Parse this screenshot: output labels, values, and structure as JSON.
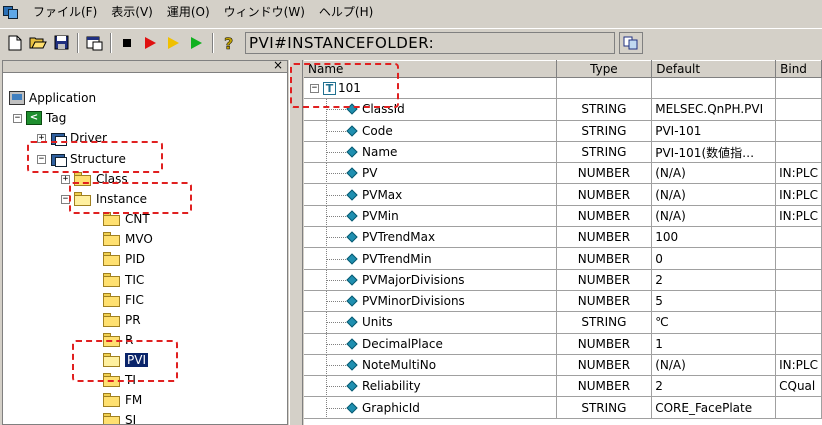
{
  "menu": {
    "items": [
      "ファイル(F)",
      "表示(V)",
      "運用(O)",
      "ウィンドウ(W)",
      "ヘルプ(H)"
    ]
  },
  "toolbar": {
    "path_value": "PVI#INSTANCEFOLDER:"
  },
  "tree": {
    "close_label": "×",
    "nodes": [
      {
        "label": "Application",
        "expander": ""
      },
      {
        "label": "Tag",
        "expander": "−"
      },
      {
        "label": "Driver",
        "expander": "+"
      },
      {
        "label": "Structure",
        "expander": "−"
      },
      {
        "label": "Class",
        "expander": "+"
      },
      {
        "label": "Instance",
        "expander": "−"
      },
      {
        "label": "CNT"
      },
      {
        "label": "MVO"
      },
      {
        "label": "PID"
      },
      {
        "label": "TIC"
      },
      {
        "label": "FIC"
      },
      {
        "label": "PR"
      },
      {
        "label": "R"
      },
      {
        "label": "PVI"
      },
      {
        "label": "TI"
      },
      {
        "label": "FM"
      },
      {
        "label": "SI"
      }
    ]
  },
  "grid": {
    "columns": [
      "Name",
      "Type",
      "Default",
      "Bind"
    ],
    "root": {
      "label": "101",
      "expander": "−"
    },
    "rows": [
      {
        "name": "ClassId",
        "type": "STRING",
        "default": "MELSEC.QnPH.PVI",
        "bind": ""
      },
      {
        "name": "Code",
        "type": "STRING",
        "default": "PVI-101",
        "bind": ""
      },
      {
        "name": "Name",
        "type": "STRING",
        "default": "PVI-101(数値指…",
        "bind": ""
      },
      {
        "name": "PV",
        "type": "NUMBER",
        "default": "(N/A)",
        "bind": "IN:PLC"
      },
      {
        "name": "PVMax",
        "type": "NUMBER",
        "default": "(N/A)",
        "bind": "IN:PLC"
      },
      {
        "name": "PVMin",
        "type": "NUMBER",
        "default": "(N/A)",
        "bind": "IN:PLC"
      },
      {
        "name": "PVTrendMax",
        "type": "NUMBER",
        "default": "100",
        "bind": ""
      },
      {
        "name": "PVTrendMin",
        "type": "NUMBER",
        "default": "0",
        "bind": ""
      },
      {
        "name": "PVMajorDivisions",
        "type": "NUMBER",
        "default": "2",
        "bind": ""
      },
      {
        "name": "PVMinorDivisions",
        "type": "NUMBER",
        "default": "5",
        "bind": ""
      },
      {
        "name": "Units",
        "type": "STRING",
        "default": "℃",
        "bind": ""
      },
      {
        "name": "DecimalPlace",
        "type": "NUMBER",
        "default": "1",
        "bind": ""
      },
      {
        "name": "NoteMultiNo",
        "type": "NUMBER",
        "default": "(N/A)",
        "bind": "IN:PLC"
      },
      {
        "name": "Reliability",
        "type": "NUMBER",
        "default": "2",
        "bind": "CQual"
      },
      {
        "name": "GraphicId",
        "type": "STRING",
        "default": "CORE_FacePlate",
        "bind": ""
      }
    ]
  },
  "colors": {
    "highlight": "#e02020",
    "selection": "#0a246a",
    "chrome": "#d4d0c8"
  }
}
